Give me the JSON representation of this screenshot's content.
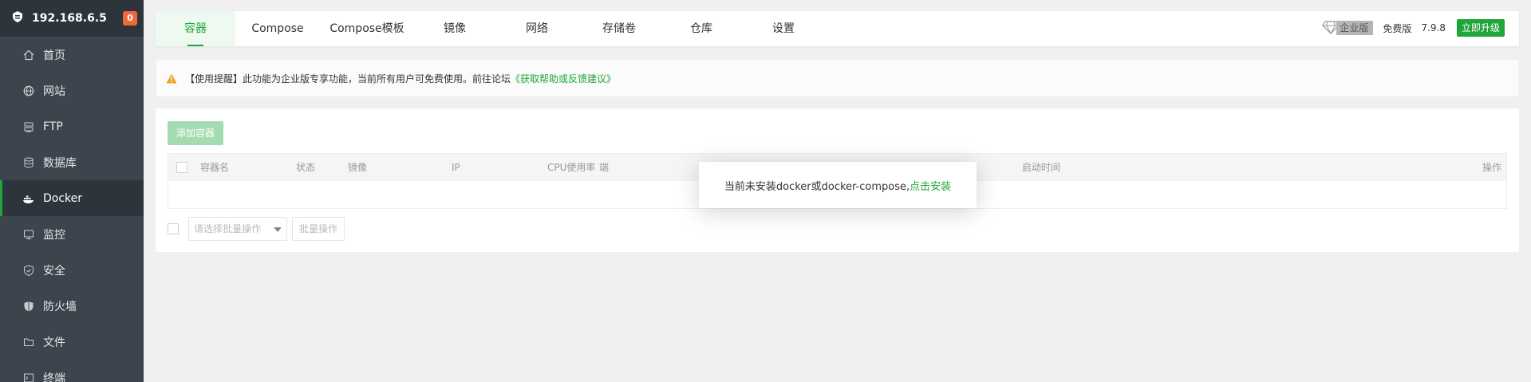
{
  "sidebar": {
    "ip": "192.168.6.5",
    "badge": "0",
    "items": [
      {
        "label": "首页",
        "icon": "home-icon"
      },
      {
        "label": "网站",
        "icon": "globe-icon"
      },
      {
        "label": "FTP",
        "icon": "ftp-icon"
      },
      {
        "label": "数据库",
        "icon": "database-icon"
      },
      {
        "label": "Docker",
        "icon": "docker-icon",
        "active": true
      },
      {
        "label": "监控",
        "icon": "monitor-icon"
      },
      {
        "label": "安全",
        "icon": "shield-icon"
      },
      {
        "label": "防火墙",
        "icon": "firewall-icon"
      },
      {
        "label": "文件",
        "icon": "folder-icon"
      },
      {
        "label": "终端",
        "icon": "terminal-icon"
      }
    ]
  },
  "tabs": [
    {
      "label": "容器",
      "active": true
    },
    {
      "label": "Compose"
    },
    {
      "label": "Compose模板"
    },
    {
      "label": "镜像"
    },
    {
      "label": "网络"
    },
    {
      "label": "存储卷"
    },
    {
      "label": "仓库"
    },
    {
      "label": "设置"
    }
  ],
  "topright": {
    "enterprise_label": "企业版",
    "free_label": "免费版",
    "version": "7.9.8",
    "upgrade_label": "立即升级"
  },
  "notice": {
    "prefix": "【使用提醒】此功能为企业版专享功能，当前所有用户可免费使用。前往论坛",
    "link": "《获取帮助或反馈建议》"
  },
  "panel": {
    "add_button": "添加容器",
    "columns": [
      "容器名",
      "状态",
      "镜像",
      "IP",
      "CPU使用率",
      "端",
      "启动时间",
      "操作"
    ],
    "batch_placeholder": "请选择批量操作",
    "batch_button": "批量操作"
  },
  "modal": {
    "message": "当前未安装docker或docker-compose,",
    "install_link": "点击安装"
  },
  "colors": {
    "accent": "#20a53a",
    "sidebar_bg": "#3c444d",
    "sidebar_active": "#2e343b",
    "badge": "#f0673a",
    "warning": "#f0a020"
  }
}
